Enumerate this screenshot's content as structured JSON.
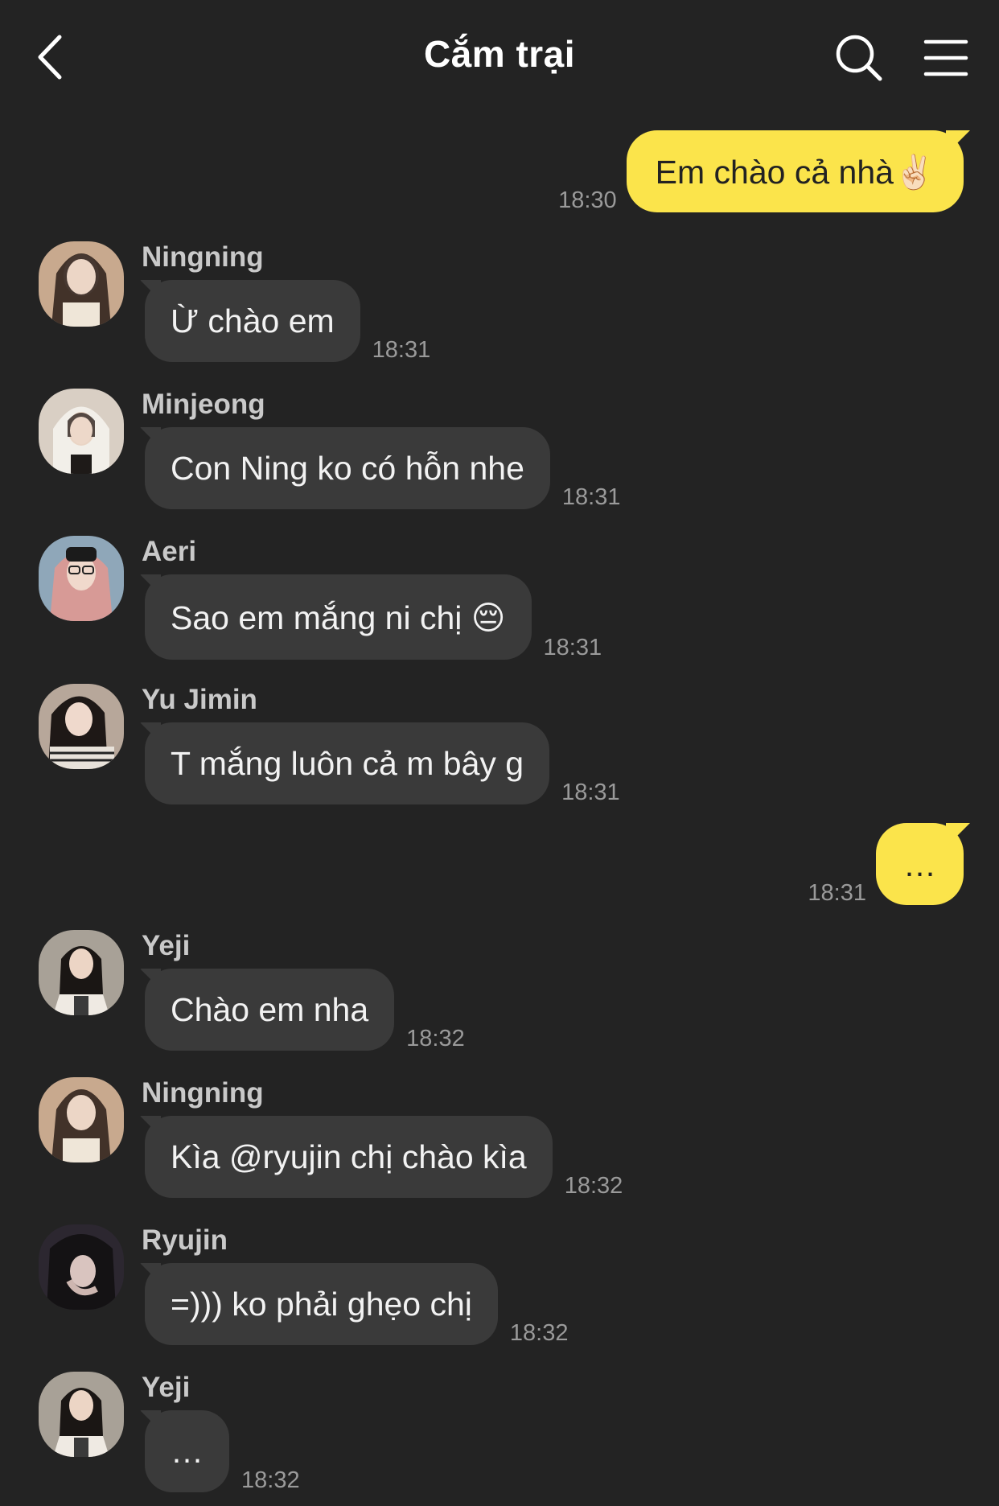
{
  "header": {
    "title": "Cắm trại"
  },
  "messages": [
    {
      "from": "me",
      "text": "Em chào cả nhà✌🏻",
      "time": "18:30"
    },
    {
      "from": "Ningning",
      "text": "Ừ chào em",
      "time": "18:31",
      "avatar_color": "#c8a98e"
    },
    {
      "from": "Minjeong",
      "text": "Con Ning ko có hỗn nhe",
      "time": "18:31",
      "avatar_color": "#d9cfc4"
    },
    {
      "from": "Aeri",
      "text": "Sao em mắng ni chị 😔",
      "time": "18:31",
      "avatar_color": "#d49a95"
    },
    {
      "from": "Yu Jimin",
      "text": "T mắng luôn cả m bây g",
      "time": "18:31",
      "avatar_color": "#b7a79a"
    },
    {
      "from": "me",
      "text": "…",
      "time": "18:31"
    },
    {
      "from": "Yeji",
      "text": "Chào em nha",
      "time": "18:32",
      "avatar_color": "#a8a197"
    },
    {
      "from": "Ningning",
      "text": "Kìa @ryujin chị chào kìa",
      "time": "18:32",
      "avatar_color": "#c8a98e"
    },
    {
      "from": "Ryujin",
      "text": "=))) ko phải ghẹo chị",
      "time": "18:32",
      "avatar_color": "#2c2730"
    },
    {
      "from": "Yeji",
      "text": "…",
      "time": "18:32",
      "avatar_color": "#a8a197"
    }
  ],
  "icons": [
    "back-icon",
    "search-icon",
    "menu-icon"
  ],
  "colors": {
    "background": "#232323",
    "incoming_bubble": "#3a3a3a",
    "outgoing_bubble": "#fbe44b"
  }
}
